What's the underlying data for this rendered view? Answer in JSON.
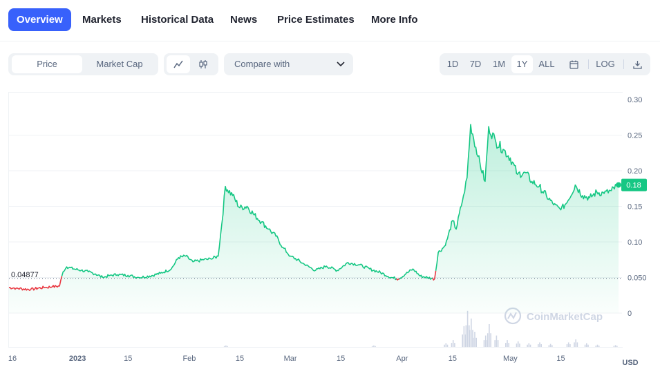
{
  "nav": {
    "tabs": [
      {
        "label": "Overview",
        "active": true
      },
      {
        "label": "Markets"
      },
      {
        "label": "Historical Data"
      },
      {
        "label": "News"
      },
      {
        "label": "Price Estimates"
      },
      {
        "label": "More Info"
      }
    ]
  },
  "toolbar": {
    "metric_tabs": [
      "Price",
      "Market Cap"
    ],
    "active_metric": "Price",
    "chart_style_icons": [
      "line-chart-icon",
      "candlestick-icon"
    ],
    "compare_label": "Compare with",
    "ranges": [
      "1D",
      "7D",
      "1M",
      "1Y",
      "ALL"
    ],
    "active_range": "1Y",
    "log_label": "LOG",
    "calendar_icon": "calendar-icon",
    "download_icon": "download-icon"
  },
  "colors": {
    "accent": "#3861fb",
    "up": "#16c784",
    "down": "#ea3943"
  },
  "chart": {
    "watermark": "CoinMarketCap",
    "currency": "USD",
    "reference_label": "0.04877",
    "current_label": "0.18"
  },
  "chart_data": {
    "type": "area",
    "y_ticks": [
      "0.30",
      "0.25",
      "0.20",
      "0.15",
      "0.10",
      "0.050",
      "0"
    ],
    "ylim": [
      0,
      0.3
    ],
    "x_ticks": [
      "16",
      "2023",
      "15",
      "Feb",
      "15",
      "Mar",
      "15",
      "Apr",
      "15",
      "May",
      "15"
    ],
    "reference_value": 0.04877,
    "current_value": 0.18,
    "series": [
      {
        "points": [
          [
            "2022-12-13",
            0.036
          ],
          [
            "2022-12-15",
            0.035
          ],
          [
            "2022-12-17",
            0.034
          ],
          [
            "2022-12-19",
            0.033
          ],
          [
            "2022-12-21",
            0.035
          ],
          [
            "2022-12-23",
            0.036
          ],
          [
            "2022-12-25",
            0.037
          ],
          [
            "2022-12-27",
            0.038
          ],
          [
            "2022-12-28",
            0.058
          ],
          [
            "2022-12-29",
            0.065
          ],
          [
            "2022-12-31",
            0.062
          ],
          [
            "2023-01-02",
            0.06
          ],
          [
            "2023-01-04",
            0.058
          ],
          [
            "2023-01-06",
            0.055
          ],
          [
            "2023-01-08",
            0.05
          ],
          [
            "2023-01-10",
            0.053
          ],
          [
            "2023-01-12",
            0.054
          ],
          [
            "2023-01-15",
            0.053
          ],
          [
            "2023-01-18",
            0.05
          ],
          [
            "2023-01-21",
            0.052
          ],
          [
            "2023-01-24",
            0.056
          ],
          [
            "2023-01-27",
            0.062
          ],
          [
            "2023-01-29",
            0.078
          ],
          [
            "2023-01-31",
            0.08
          ],
          [
            "2023-02-02",
            0.072
          ],
          [
            "2023-02-05",
            0.075
          ],
          [
            "2023-02-07",
            0.076
          ],
          [
            "2023-02-09",
            0.08
          ],
          [
            "2023-02-10",
            0.125
          ],
          [
            "2023-02-11",
            0.178
          ],
          [
            "2023-02-13",
            0.165
          ],
          [
            "2023-02-15",
            0.148
          ],
          [
            "2023-02-17",
            0.15
          ],
          [
            "2023-02-19",
            0.138
          ],
          [
            "2023-02-21",
            0.128
          ],
          [
            "2023-02-23",
            0.118
          ],
          [
            "2023-02-25",
            0.108
          ],
          [
            "2023-02-27",
            0.092
          ],
          [
            "2023-03-01",
            0.08
          ],
          [
            "2023-03-03",
            0.075
          ],
          [
            "2023-03-05",
            0.068
          ],
          [
            "2023-03-08",
            0.06
          ],
          [
            "2023-03-11",
            0.066
          ],
          [
            "2023-03-14",
            0.06
          ],
          [
            "2023-03-17",
            0.071
          ],
          [
            "2023-03-20",
            0.068
          ],
          [
            "2023-03-23",
            0.062
          ],
          [
            "2023-03-26",
            0.057
          ],
          [
            "2023-03-29",
            0.05
          ],
          [
            "2023-03-31",
            0.048
          ],
          [
            "2023-04-02",
            0.055
          ],
          [
            "2023-04-04",
            0.062
          ],
          [
            "2023-04-06",
            0.052
          ],
          [
            "2023-04-08",
            0.05
          ],
          [
            "2023-04-10",
            0.048
          ],
          [
            "2023-04-11",
            0.085
          ],
          [
            "2023-04-13",
            0.095
          ],
          [
            "2023-04-15",
            0.13
          ],
          [
            "2023-04-16",
            0.118
          ],
          [
            "2023-04-18",
            0.165
          ],
          [
            "2023-04-19",
            0.19
          ],
          [
            "2023-04-20",
            0.265
          ],
          [
            "2023-04-22",
            0.22
          ],
          [
            "2023-04-24",
            0.185
          ],
          [
            "2023-04-25",
            0.262
          ],
          [
            "2023-04-27",
            0.24
          ],
          [
            "2023-04-29",
            0.23
          ],
          [
            "2023-05-01",
            0.218
          ],
          [
            "2023-05-03",
            0.195
          ],
          [
            "2023-05-05",
            0.198
          ],
          [
            "2023-05-07",
            0.185
          ],
          [
            "2023-05-09",
            0.178
          ],
          [
            "2023-05-11",
            0.165
          ],
          [
            "2023-05-13",
            0.152
          ],
          [
            "2023-05-15",
            0.145
          ],
          [
            "2023-05-17",
            0.158
          ],
          [
            "2023-05-19",
            0.18
          ],
          [
            "2023-05-21",
            0.165
          ],
          [
            "2023-05-23",
            0.162
          ],
          [
            "2023-05-25",
            0.17
          ],
          [
            "2023-05-27",
            0.168
          ],
          [
            "2023-05-29",
            0.172
          ],
          [
            "2023-05-31",
            0.18
          ]
        ]
      }
    ],
    "volume": [
      [
        "2023-02-11",
        0.04
      ],
      [
        "2023-03-24",
        0.04
      ],
      [
        "2023-04-13",
        0.1
      ],
      [
        "2023-04-15",
        0.18
      ],
      [
        "2023-04-18",
        0.55
      ],
      [
        "2023-04-19",
        0.95
      ],
      [
        "2023-04-20",
        0.75
      ],
      [
        "2023-04-21",
        0.4
      ],
      [
        "2023-04-24",
        0.3
      ],
      [
        "2023-04-25",
        0.6
      ],
      [
        "2023-04-27",
        0.3
      ],
      [
        "2023-04-30",
        0.18
      ],
      [
        "2023-05-03",
        0.15
      ],
      [
        "2023-05-06",
        0.1
      ],
      [
        "2023-05-09",
        0.12
      ],
      [
        "2023-05-12",
        0.08
      ],
      [
        "2023-05-17",
        0.12
      ],
      [
        "2023-05-19",
        0.2
      ],
      [
        "2023-05-22",
        0.1
      ],
      [
        "2023-05-25",
        0.06
      ],
      [
        "2023-05-30",
        0.05
      ]
    ]
  }
}
